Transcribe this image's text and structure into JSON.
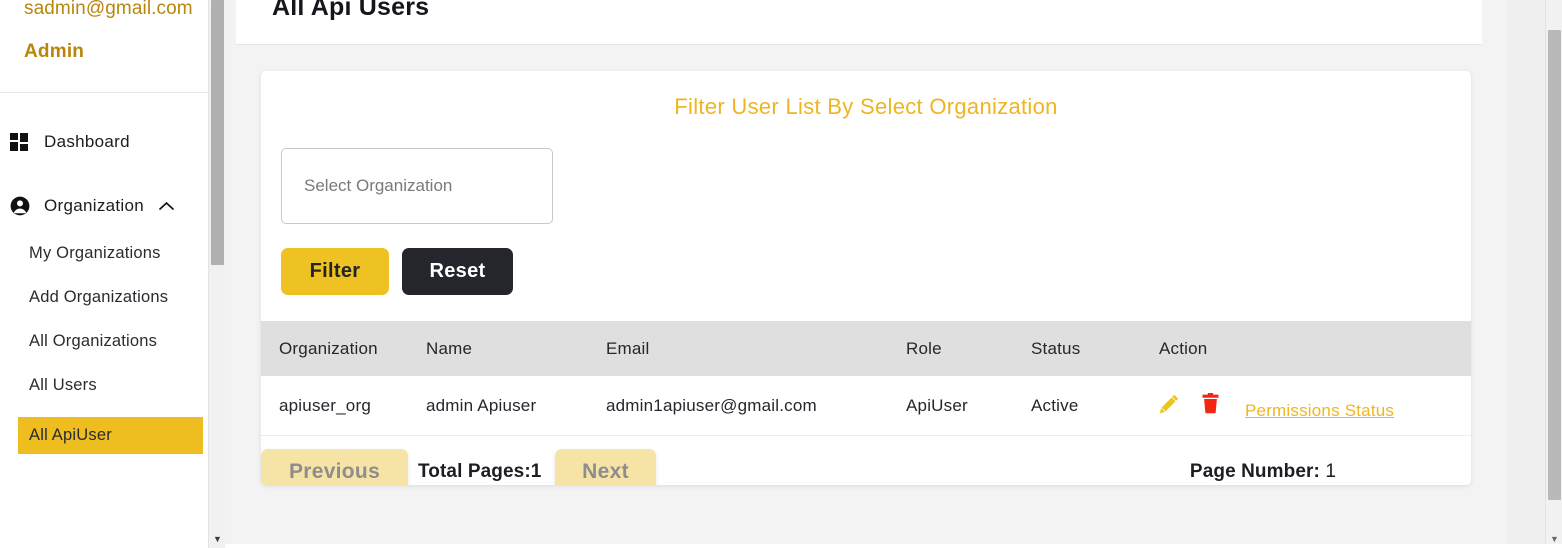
{
  "sidebar": {
    "user_email": "sadmin@gmail.com",
    "user_role": "Admin",
    "nav": [
      {
        "label": "Dashboard",
        "icon": "grid-icon"
      },
      {
        "label": "Organization",
        "icon": "user-circle-icon",
        "chevron": "chevron-up-icon"
      }
    ],
    "sub_items": [
      {
        "label": "My Organizations",
        "active": false
      },
      {
        "label": "Add Organizations",
        "active": false
      },
      {
        "label": "All Organizations",
        "active": false
      },
      {
        "label": "All Users",
        "active": false
      },
      {
        "label": "All ApiUser",
        "active": true
      }
    ]
  },
  "header": {
    "title": "All Api Users"
  },
  "filter": {
    "title": "Filter User List By Select Organization",
    "select_placeholder": "Select Organization",
    "select_value": "",
    "filter_label": "Filter",
    "reset_label": "Reset"
  },
  "table": {
    "columns": [
      "Organization",
      "Name",
      "Email",
      "Role",
      "Status",
      "Action"
    ],
    "rows": [
      {
        "organization": "apiuser_org",
        "name": "admin Apiuser",
        "email": "admin1apiuser@gmail.com",
        "role": "ApiUser",
        "status": "Active",
        "edit_icon": "pencil-icon",
        "delete_icon": "trash-icon",
        "permissions_link": "Permissions Status"
      }
    ]
  },
  "pagination": {
    "previous_label": "Previous",
    "next_label": "Next",
    "total_pages_label": "Total Pages:1",
    "page_number_label": "Page Number:",
    "page_number_value": "1"
  },
  "colors": {
    "accent_yellow": "#eec222",
    "link_yellow": "#efb61f",
    "brand_gold": "#b8860b",
    "dark_button": "#25262b",
    "pager_yellow": "#f6e4a6",
    "delete_red": "#f22613",
    "table_header_grey": "#dfdfdf"
  }
}
